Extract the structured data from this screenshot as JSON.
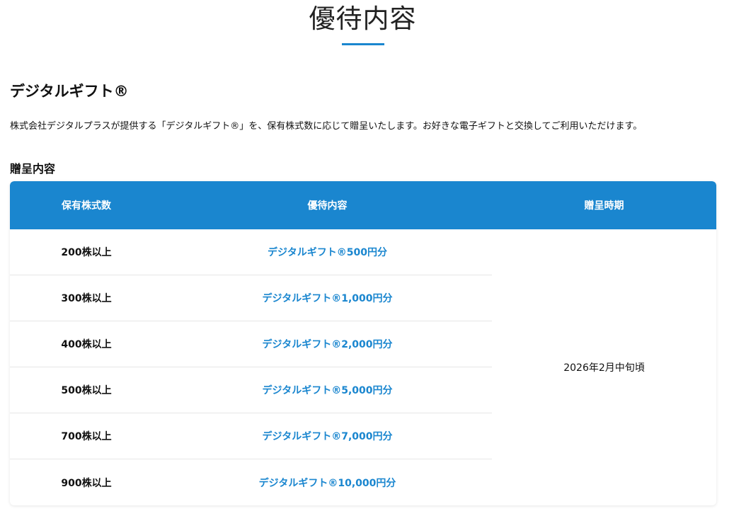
{
  "page": {
    "title": "優待内容"
  },
  "section": {
    "title": "デジタルギフト®",
    "description": "株式会社デジタルプラスが提供する「デジタルギフト®」を、保有株式数に応じて贈呈いたします。お好きな電子ギフトと交換してご利用いただけます。"
  },
  "table": {
    "title": "贈呈内容",
    "headers": {
      "shares": "保有株式数",
      "benefit": "優待内容",
      "timing": "贈呈時期"
    },
    "rows": [
      {
        "shares": "200株以上",
        "benefit": "デジタルギフト®500円分"
      },
      {
        "shares": "300株以上",
        "benefit": "デジタルギフト®1,000円分"
      },
      {
        "shares": "400株以上",
        "benefit": "デジタルギフト®2,000円分"
      },
      {
        "shares": "500株以上",
        "benefit": "デジタルギフト®5,000円分"
      },
      {
        "shares": "700株以上",
        "benefit": "デジタルギフト®7,000円分"
      },
      {
        "shares": "900株以上",
        "benefit": "デジタルギフト®10,000円分"
      }
    ],
    "timing": "2026年2月中旬頃"
  },
  "colors": {
    "accent": "#1a86cf",
    "text": "#111111",
    "divider": "#e6e6e6"
  }
}
